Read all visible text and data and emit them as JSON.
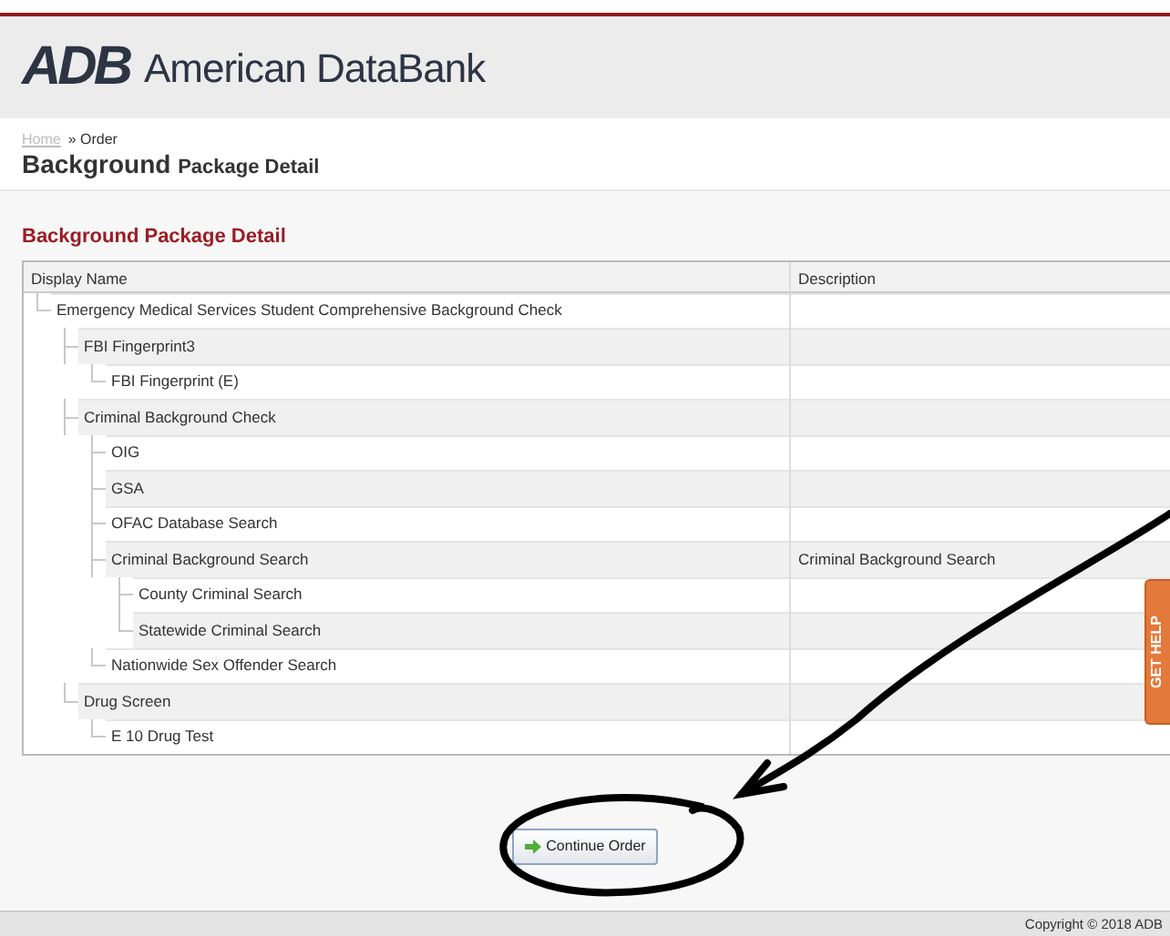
{
  "header": {
    "logo_mark": "ADB",
    "brand": "American DataBank"
  },
  "breadcrumb": [
    {
      "label": "Home",
      "kind": "link"
    },
    {
      "label": "» Order",
      "kind": "text"
    }
  ],
  "page_title": {
    "main": "Background",
    "sub": "Package Detail"
  },
  "section_title": "Background Package Detail",
  "table": {
    "columns": [
      "Display Name",
      "Description"
    ],
    "rows": [
      {
        "name": "Emergency Medical Services Student Comprehensive Background Check",
        "children": [
          {
            "name": "FBI Fingerprint3",
            "children": [
              {
                "name": "FBI Fingerprint (E)"
              }
            ]
          },
          {
            "name": "Criminal Background Check",
            "children": [
              {
                "name": "OIG"
              },
              {
                "name": "GSA"
              },
              {
                "name": "OFAC Database Search"
              },
              {
                "name": "Criminal Background Search",
                "description": "Criminal Background Search",
                "children": [
                  {
                    "name": "County Criminal Search"
                  },
                  {
                    "name": "Statewide Criminal Search"
                  }
                ]
              },
              {
                "name": "Nationwide Sex Offender Search"
              }
            ]
          },
          {
            "name": "Drug Screen",
            "children": [
              {
                "name": "E 10 Drug Test"
              }
            ]
          }
        ]
      }
    ]
  },
  "continue_button": "Continue Order",
  "help_tab": "GET HELP",
  "footer": "Copyright © 2018 ADB"
}
